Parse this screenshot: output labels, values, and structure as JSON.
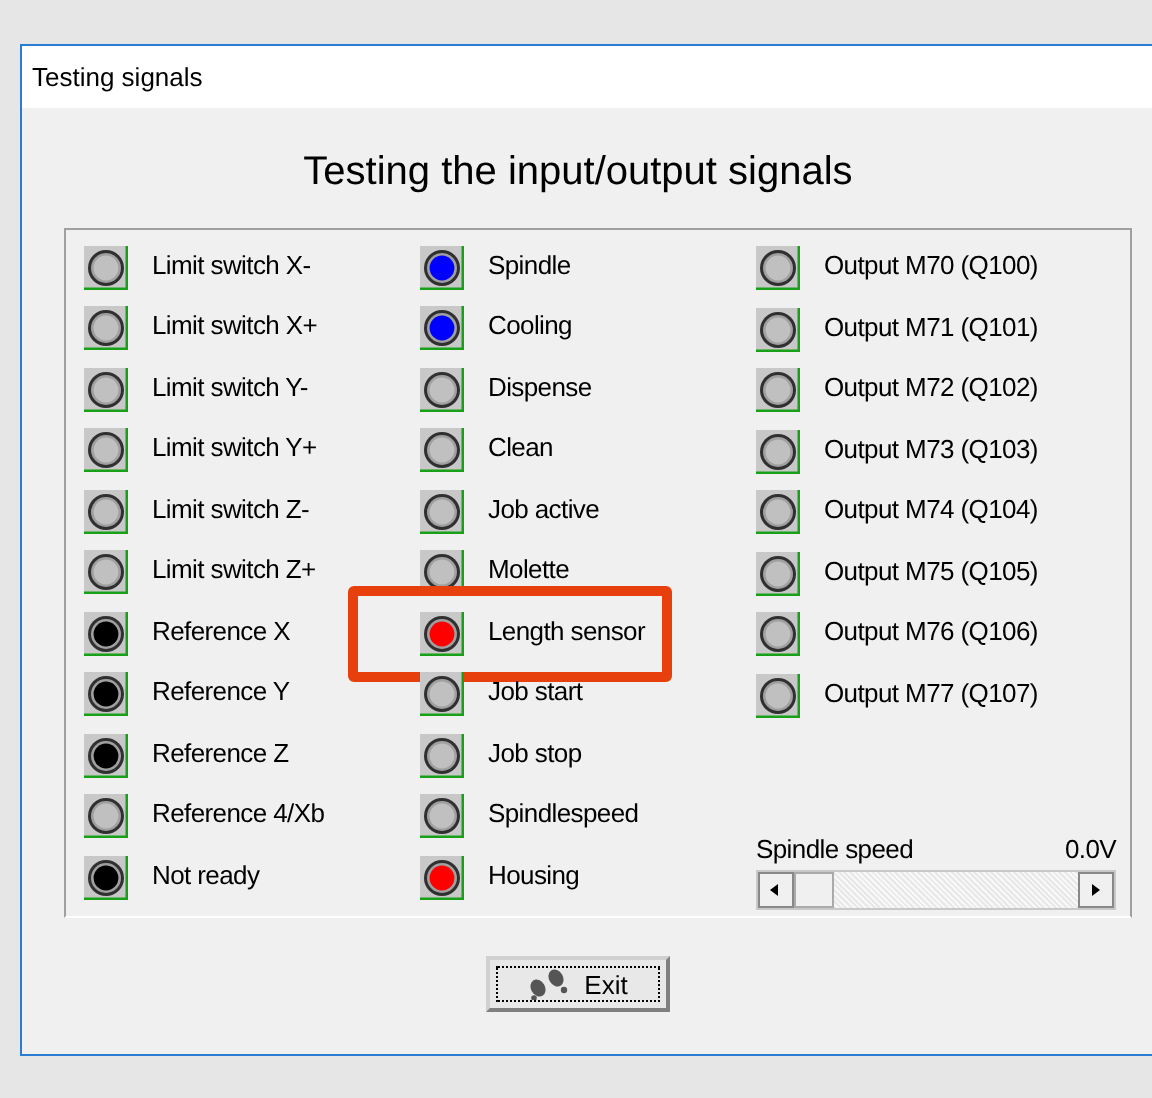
{
  "window": {
    "title": "Testing signals"
  },
  "heading": "Testing the input/output signals",
  "columns": [
    [
      {
        "label": "Limit switch X-",
        "color": "#c0c0c0",
        "highlighted": false
      },
      {
        "label": "Limit switch X+",
        "color": "#c0c0c0",
        "highlighted": false
      },
      {
        "label": "Limit switch Y-",
        "color": "#c0c0c0",
        "highlighted": false
      },
      {
        "label": "Limit switch Y+",
        "color": "#c0c0c0",
        "highlighted": false
      },
      {
        "label": "Limit switch Z-",
        "color": "#c0c0c0",
        "highlighted": false
      },
      {
        "label": "Limit switch Z+",
        "color": "#c0c0c0",
        "highlighted": false
      },
      {
        "label": "Reference X",
        "color": "#000000",
        "highlighted": false
      },
      {
        "label": "Reference Y",
        "color": "#000000",
        "highlighted": false
      },
      {
        "label": "Reference Z",
        "color": "#000000",
        "highlighted": false
      },
      {
        "label": "Reference 4/Xb",
        "color": "#c0c0c0",
        "highlighted": false
      },
      {
        "label": "Not ready",
        "color": "#000000",
        "highlighted": false
      }
    ],
    [
      {
        "label": "Spindle",
        "color": "#0000ff",
        "highlighted": false
      },
      {
        "label": "Cooling",
        "color": "#0000ff",
        "highlighted": false
      },
      {
        "label": "Dispense",
        "color": "#c0c0c0",
        "highlighted": false
      },
      {
        "label": "Clean",
        "color": "#c0c0c0",
        "highlighted": false
      },
      {
        "label": "Job active",
        "color": "#c0c0c0",
        "highlighted": false
      },
      {
        "label": "Molette",
        "color": "#c0c0c0",
        "highlighted": false
      },
      {
        "label": "Length sensor",
        "color": "#ff0000",
        "highlighted": true
      },
      {
        "label": "Job start",
        "color": "#c0c0c0",
        "highlighted": false
      },
      {
        "label": "Job stop",
        "color": "#c0c0c0",
        "highlighted": false
      },
      {
        "label": "Spindlespeed",
        "color": "#c0c0c0",
        "highlighted": false
      },
      {
        "label": "Housing",
        "color": "#ff0000",
        "highlighted": false
      }
    ],
    [
      {
        "label": "Output M70 (Q100)",
        "color": "#c0c0c0",
        "highlighted": false
      },
      {
        "label": "Output M71 (Q101)",
        "color": "#c0c0c0",
        "highlighted": false
      },
      {
        "label": "Output M72 (Q102)",
        "color": "#c0c0c0",
        "highlighted": false
      },
      {
        "label": "Output M73 (Q103)",
        "color": "#c0c0c0",
        "highlighted": false
      },
      {
        "label": "Output M74 (Q104)",
        "color": "#c0c0c0",
        "highlighted": false
      },
      {
        "label": "Output M75 (Q105)",
        "color": "#c0c0c0",
        "highlighted": false
      },
      {
        "label": "Output M76 (Q106)",
        "color": "#c0c0c0",
        "highlighted": false
      },
      {
        "label": "Output M77 (Q107)",
        "color": "#c0c0c0",
        "highlighted": false
      }
    ]
  ],
  "spindle_speed": {
    "label": "Spindle speed",
    "reading": "0.0V",
    "level": 0
  },
  "exit_button": {
    "label": "Exit"
  }
}
